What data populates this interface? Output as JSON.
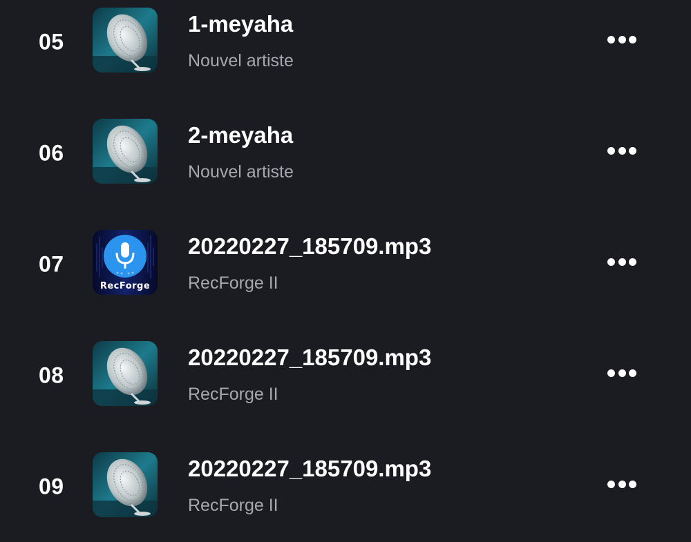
{
  "tracks": [
    {
      "number": "05",
      "title": "1-meyaha",
      "subtitle": "Nouvel artiste",
      "art": "speaker-art"
    },
    {
      "number": "06",
      "title": "2-meyaha",
      "subtitle": "Nouvel artiste",
      "art": "speaker-art"
    },
    {
      "number": "07",
      "title": "20220227_185709.mp3",
      "subtitle": "RecForge II",
      "art": "recforge-art",
      "art_label": "RecForge"
    },
    {
      "number": "08",
      "title": "20220227_185709.mp3",
      "subtitle": "RecForge II",
      "art": "speaker-art"
    },
    {
      "number": "09",
      "title": "20220227_185709.mp3",
      "subtitle": "RecForge II",
      "art": "speaker-art"
    }
  ],
  "more_icon": "more-horizontal-icon",
  "colors": {
    "background": "#1b1b22",
    "title": "#ffffff",
    "subtitle": "#a7a7ad",
    "recforge_blue": "#1f8fe8"
  }
}
